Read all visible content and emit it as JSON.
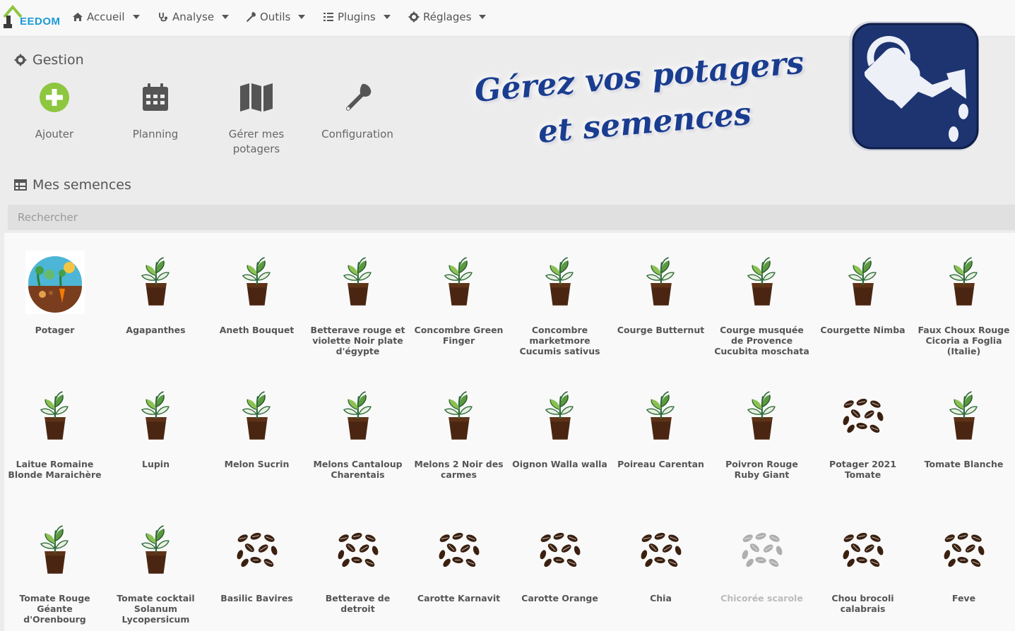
{
  "brand": {
    "logo_text": "EEDOM"
  },
  "nav": [
    {
      "label": "Accueil",
      "icon": "home-icon"
    },
    {
      "label": "Analyse",
      "icon": "stethoscope-icon"
    },
    {
      "label": "Outils",
      "icon": "wrench-icon"
    },
    {
      "label": "Plugins",
      "icon": "list-icon"
    },
    {
      "label": "Réglages",
      "icon": "gear-icon"
    }
  ],
  "gestion": {
    "title": "Gestion",
    "actions": [
      {
        "label": "Ajouter",
        "icon": "add-circle-icon",
        "color": "#8dc63f"
      },
      {
        "label": "Planning",
        "icon": "calendar-icon"
      },
      {
        "label": "Gérer mes potagers",
        "icon": "map-icon"
      },
      {
        "label": "Configuration",
        "icon": "wrench-icon"
      }
    ]
  },
  "banner": {
    "line1": "Gérez vos potagers",
    "line2": "et semences",
    "accent": "#1a3d8f",
    "icon": "watering-can-icon"
  },
  "semences": {
    "title": "Mes semences",
    "search_placeholder": "Rechercher",
    "items": [
      {
        "label": "Potager",
        "icon": "garden-icon"
      },
      {
        "label": "Agapanthes",
        "icon": "plant-pot-icon"
      },
      {
        "label": "Aneth Bouquet",
        "icon": "plant-pot-icon"
      },
      {
        "label": "Betterave rouge et violette Noir plate d'égypte",
        "icon": "plant-pot-icon"
      },
      {
        "label": "Concombre Green Finger",
        "icon": "plant-pot-icon"
      },
      {
        "label": "Concombre marketmore Cucumis sativus",
        "icon": "plant-pot-icon"
      },
      {
        "label": "Courge Butternut",
        "icon": "plant-pot-icon"
      },
      {
        "label": "Courge musquée de Provence Cucubita moschata",
        "icon": "plant-pot-icon"
      },
      {
        "label": "Courgette Nimba",
        "icon": "plant-pot-icon"
      },
      {
        "label": "Faux Choux Rouge Cicoria a Foglia (Italie)",
        "icon": "plant-pot-icon"
      },
      {
        "label": "Laitue Romaine Blonde Maraichère",
        "icon": "plant-pot-icon"
      },
      {
        "label": "Lupin",
        "icon": "plant-pot-icon"
      },
      {
        "label": "Melon Sucrin",
        "icon": "plant-pot-icon"
      },
      {
        "label": "Melons Cantaloup Charentais",
        "icon": "plant-pot-icon"
      },
      {
        "label": "Melons 2 Noir des carmes",
        "icon": "plant-pot-icon"
      },
      {
        "label": "Oignon Walla walla",
        "icon": "plant-pot-icon"
      },
      {
        "label": "Poireau Carentan",
        "icon": "plant-pot-icon"
      },
      {
        "label": "Poivron Rouge Ruby Giant",
        "icon": "plant-pot-icon"
      },
      {
        "label": "Potager 2021 Tomate",
        "icon": "seeds-icon"
      },
      {
        "label": "Tomate Blanche",
        "icon": "plant-pot-icon"
      },
      {
        "label": "Tomate Rouge Géante d'Orenbourg",
        "icon": "plant-pot-icon"
      },
      {
        "label": "Tomate cocktail Solanum Lycopersicum",
        "icon": "plant-pot-icon"
      },
      {
        "label": "Basilic Bavires",
        "icon": "seeds-icon"
      },
      {
        "label": "Betterave de detroit",
        "icon": "seeds-icon"
      },
      {
        "label": "Carotte Karnavit",
        "icon": "seeds-icon"
      },
      {
        "label": "Carotte Orange",
        "icon": "seeds-icon"
      },
      {
        "label": "Chia",
        "icon": "seeds-icon"
      },
      {
        "label": "Chicorée scarole",
        "icon": "seeds-icon",
        "disabled": true
      },
      {
        "label": "Chou brocoli calabrais",
        "icon": "seeds-icon"
      },
      {
        "label": "Feve",
        "icon": "seeds-icon"
      }
    ]
  }
}
